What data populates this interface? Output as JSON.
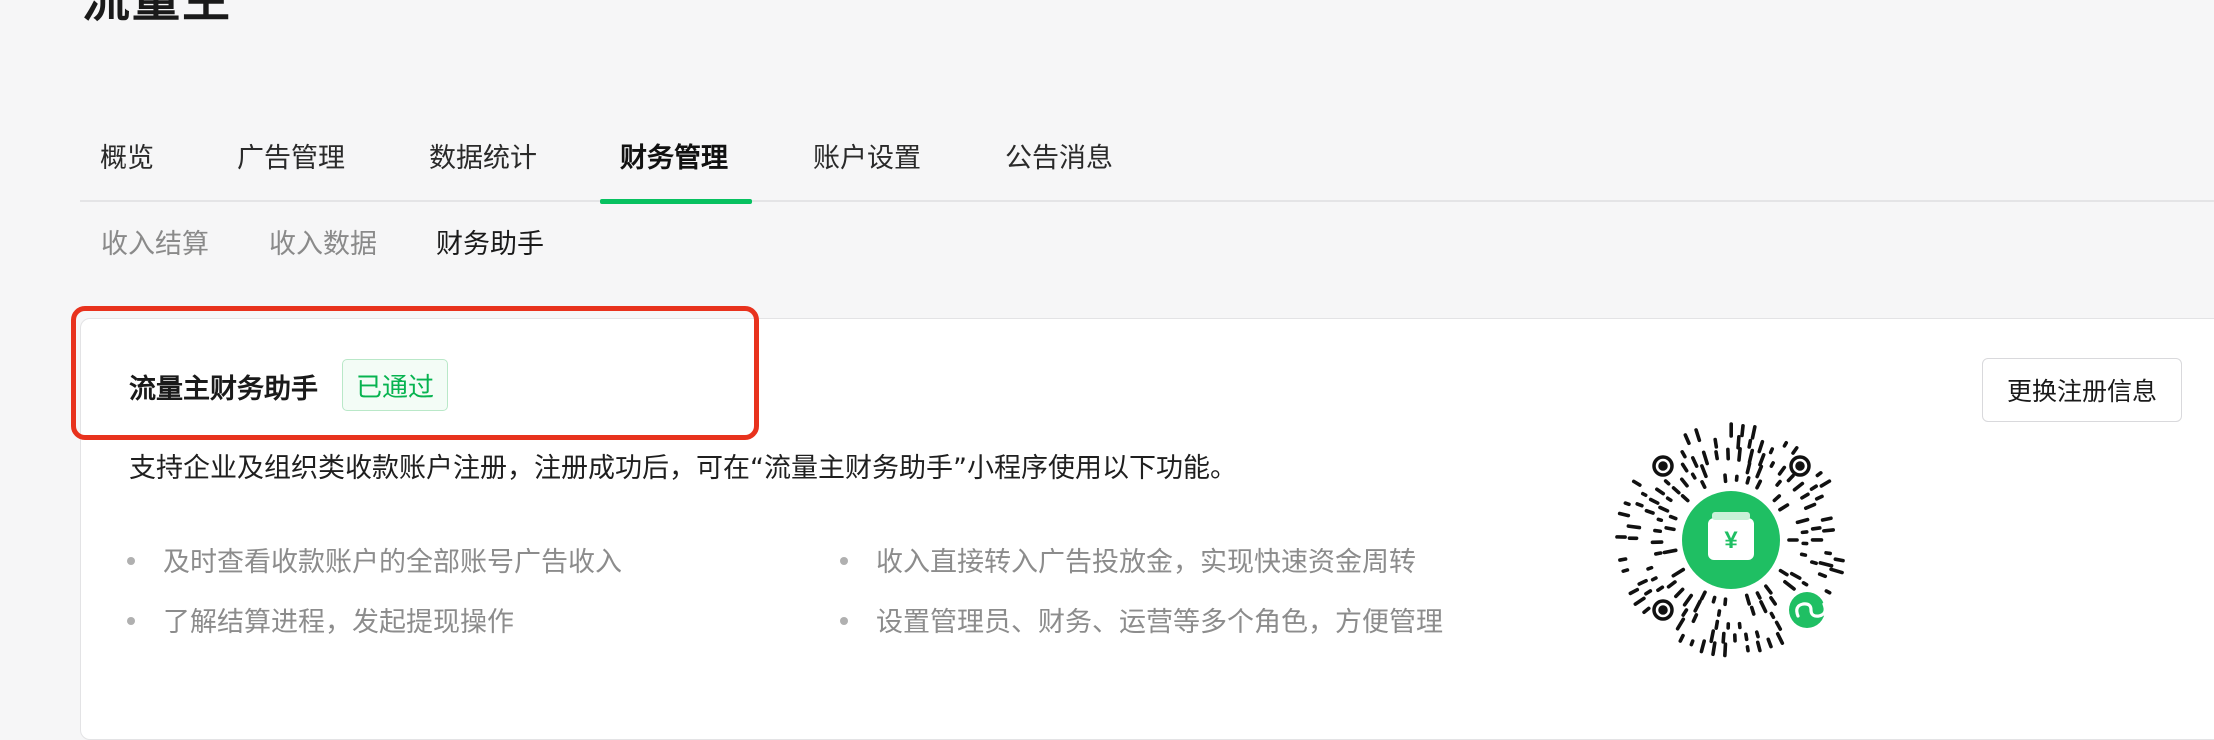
{
  "header": {
    "title": "流量主"
  },
  "main_tabs": [
    {
      "label": "概览"
    },
    {
      "label": "广告管理"
    },
    {
      "label": "数据统计"
    },
    {
      "label": "财务管理",
      "active": true
    },
    {
      "label": "账户设置"
    },
    {
      "label": "公告消息"
    }
  ],
  "sub_tabs": [
    {
      "label": "收入结算"
    },
    {
      "label": "收入数据"
    },
    {
      "label": "财务助手",
      "active": true
    }
  ],
  "card": {
    "title": "流量主财务助手",
    "status": "已通过",
    "change_button": "更换注册信息",
    "description": "支持企业及组织类收款账户注册，注册成功后，可在“流量主财务助手”小程序使用以下功能。",
    "features": [
      "及时查看收款账户的全部账号广告收入",
      "收入直接转入广告投放金，实现快速资金周转",
      "了解结算进程，发起提现操作",
      "设置管理员、财务、运营等多个角色，方便管理"
    ],
    "qr_code": {
      "icon": "wechat-mini-program-qr-code",
      "center_icon": "yen-wallet-icon"
    }
  },
  "colors": {
    "accent": "#07c160",
    "highlight": "#e8321d",
    "muted_text": "#8c8c8c"
  }
}
